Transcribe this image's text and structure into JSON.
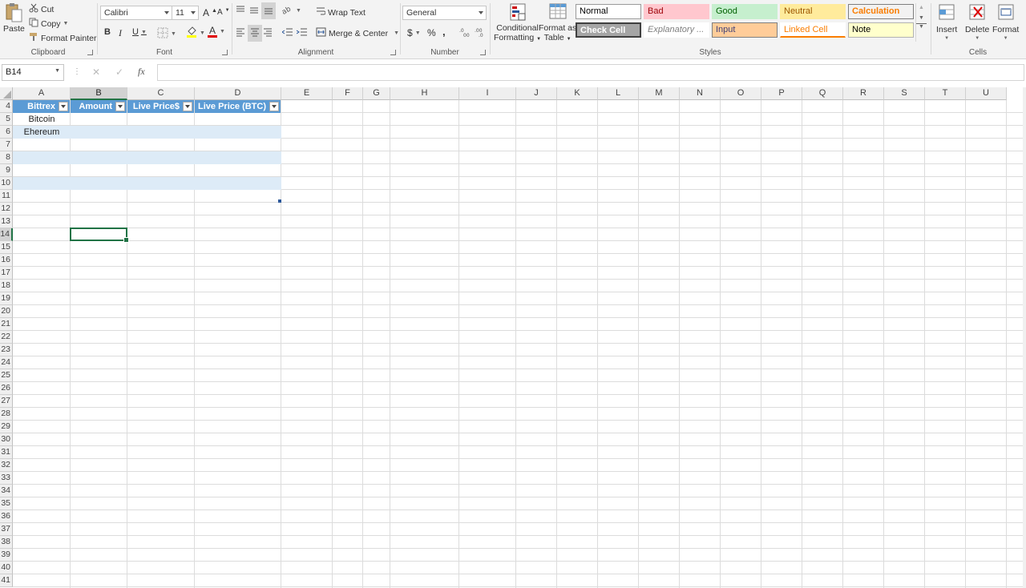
{
  "ribbon": {
    "clipboard": {
      "paste": "Paste",
      "cut": "Cut",
      "copy": "Copy",
      "format_painter": "Format Painter",
      "label": "Clipboard"
    },
    "font": {
      "family": "Calibri",
      "size": "11",
      "grow": "A",
      "shrink": "A",
      "bold": "B",
      "italic": "I",
      "underline": "U",
      "font_color_letter": "A",
      "label": "Font"
    },
    "alignment": {
      "wrap_text": "Wrap Text",
      "merge_center": "Merge & Center",
      "label": "Alignment"
    },
    "number": {
      "format": "General",
      "currency": "$",
      "percent": "%",
      "comma": ",",
      "label": "Number"
    },
    "styles": {
      "conditional_formatting": [
        "Conditional",
        "Formatting"
      ],
      "format_as_table": [
        "Format as",
        "Table"
      ],
      "cells": [
        {
          "name": "Normal",
          "bg": "#ffffff",
          "color": "#000000",
          "border": "#9a9a9a"
        },
        {
          "name": "Bad",
          "bg": "#ffc7ce",
          "color": "#9c0006",
          "border": "#ffc7ce"
        },
        {
          "name": "Good",
          "bg": "#c6efce",
          "color": "#006100",
          "border": "#c6efce"
        },
        {
          "name": "Neutral",
          "bg": "#ffeb9c",
          "color": "#9c5700",
          "border": "#ffeb9c"
        },
        {
          "name": "Calculation",
          "bg": "#f2f2f2",
          "color": "#fa7d00",
          "border": "#7f7f7f"
        },
        {
          "name": "Check Cell",
          "bg": "#a5a5a5",
          "color": "#ffffff",
          "border": "#3f3f3f"
        },
        {
          "name": "Explanatory ...",
          "bg": "#ffffff",
          "color": "#7f7f7f",
          "border": "#ffffff"
        },
        {
          "name": "Input",
          "bg": "#ffcc99",
          "color": "#3f3f76",
          "border": "#7f7f7f"
        },
        {
          "name": "Linked Cell",
          "bg": "#ffffff",
          "color": "#fa7d00",
          "border": "#ffffff"
        },
        {
          "name": "Note",
          "bg": "#ffffcc",
          "color": "#000000",
          "border": "#b2b2b2"
        }
      ],
      "label": "Styles"
    },
    "cells": {
      "insert": "Insert",
      "delete": "Delete",
      "format": "Format",
      "label": "Cells"
    }
  },
  "formula_bar": {
    "name_box": "B14",
    "fx": "fx",
    "formula": ""
  },
  "grid": {
    "columns": [
      "A",
      "B",
      "C",
      "D",
      "E",
      "F",
      "G",
      "H",
      "I",
      "J",
      "K",
      "L",
      "M",
      "N",
      "O",
      "P",
      "Q",
      "R",
      "S",
      "T",
      "U"
    ],
    "selected_column": "B",
    "rows": [
      "4",
      "5",
      "6",
      "7",
      "8",
      "9",
      "10",
      "11",
      "12",
      "13",
      "14",
      "15",
      "16",
      "17",
      "18",
      "19",
      "20",
      "21",
      "22",
      "23",
      "24",
      "25",
      "26",
      "27",
      "28",
      "29",
      "30",
      "31",
      "32",
      "33",
      "34",
      "35",
      "36",
      "37",
      "38",
      "39",
      "40",
      "41"
    ],
    "selected_row": "14",
    "table": {
      "headers": [
        "Bittrex",
        "Amount",
        "Live Price$",
        "Live Price (BTC)"
      ],
      "rows": [
        [
          "Bitcoin",
          "",
          "",
          ""
        ],
        [
          "Ehereum",
          "",
          "",
          ""
        ]
      ]
    }
  },
  "colors": {
    "accent": "#217346",
    "table_header": "#5b9bd5",
    "table_band": "#ddebf7"
  }
}
